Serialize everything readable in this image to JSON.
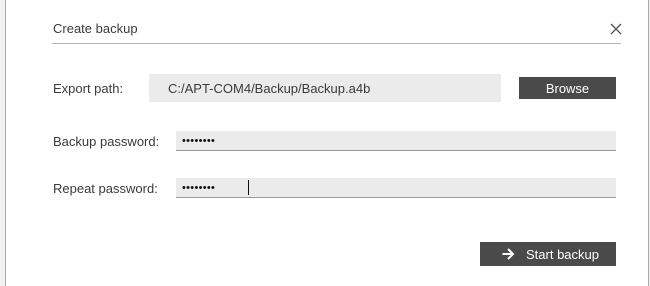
{
  "dialog": {
    "title": "Create backup",
    "close_icon": "close-icon"
  },
  "export": {
    "label": "Export path:",
    "path": "C:/APT-COM4/Backup/Backup.a4b",
    "browse_label": "Browse"
  },
  "backup_password": {
    "label": "Backup password:",
    "masked_value": "••••••••"
  },
  "repeat_password": {
    "label": "Repeat password:",
    "masked_value": "••••••••"
  },
  "actions": {
    "start_label": "Start backup",
    "start_icon": "arrow-right-icon"
  },
  "colors": {
    "button_bg": "#4a4a4a",
    "field_bg": "#ebebeb",
    "text": "#3a3a3a"
  }
}
